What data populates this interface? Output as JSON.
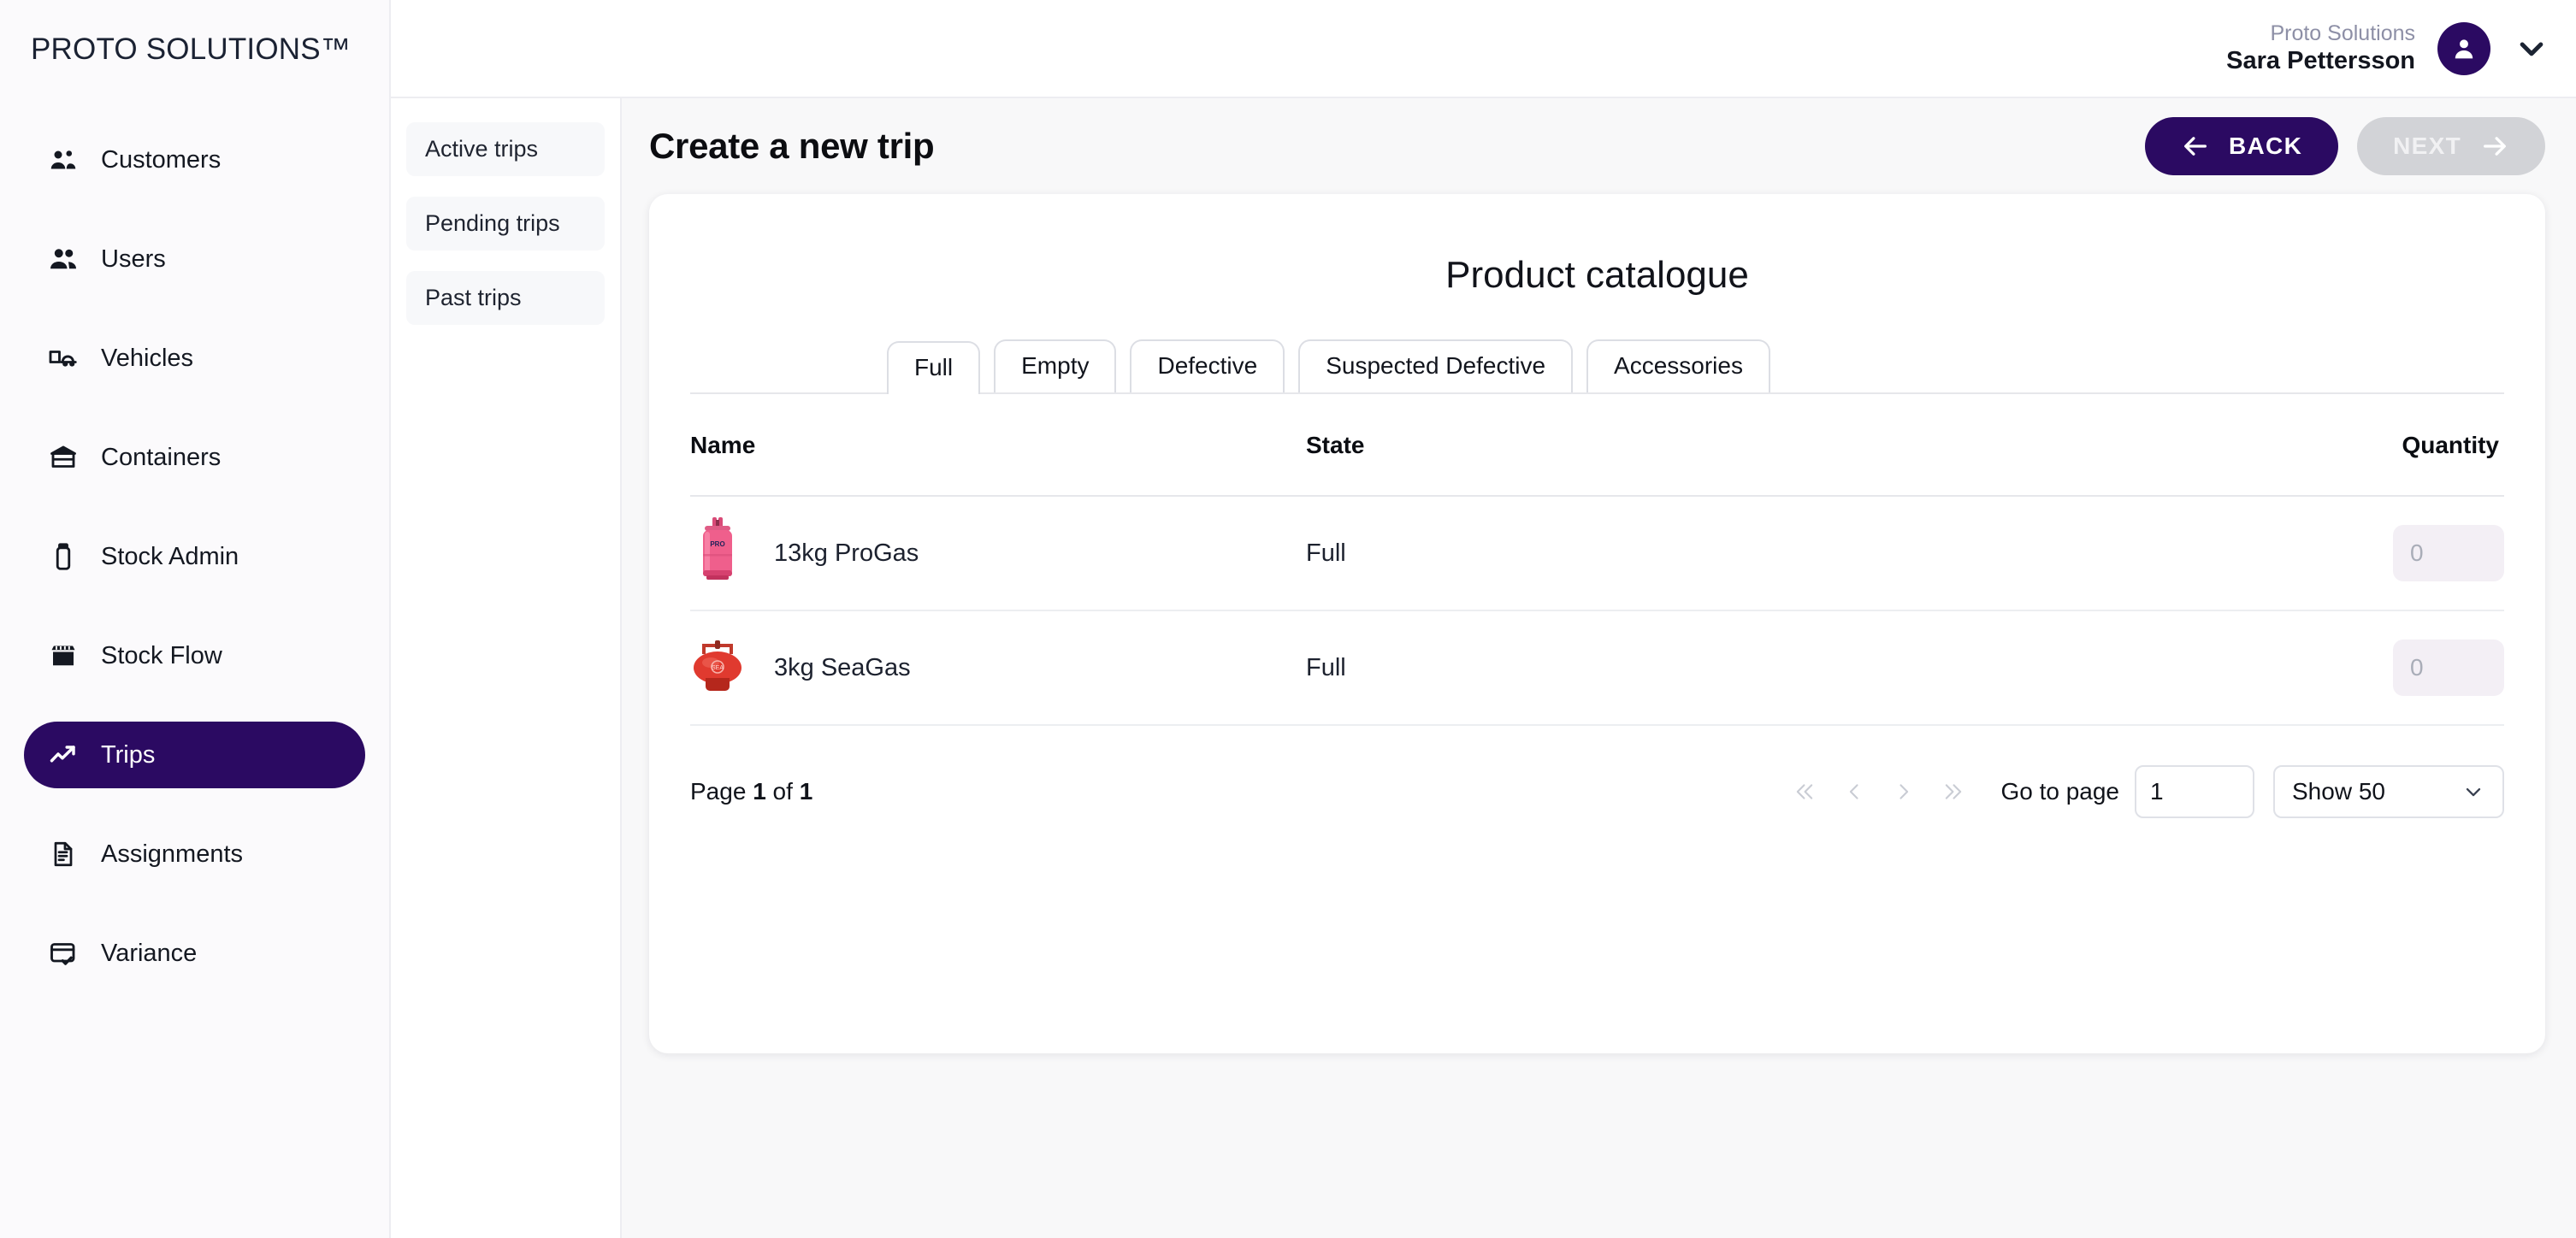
{
  "brand": "PROTO SOLUTIONS™",
  "sidebar": {
    "items": [
      {
        "label": "Customers",
        "icon": "customers-icon",
        "active": false
      },
      {
        "label": "Users",
        "icon": "users-icon",
        "active": false
      },
      {
        "label": "Vehicles",
        "icon": "vehicles-icon",
        "active": false
      },
      {
        "label": "Containers",
        "icon": "containers-icon",
        "active": false
      },
      {
        "label": "Stock Admin",
        "icon": "stock-admin-icon",
        "active": false
      },
      {
        "label": "Stock Flow",
        "icon": "stock-flow-icon",
        "active": false
      },
      {
        "label": "Trips",
        "icon": "trips-icon",
        "active": true
      },
      {
        "label": "Assignments",
        "icon": "assignments-icon",
        "active": false
      },
      {
        "label": "Variance",
        "icon": "variance-icon",
        "active": false
      }
    ],
    "active_color": "#2b0a62"
  },
  "topbar": {
    "org": "Proto Solutions",
    "user_name": "Sara Pettersson",
    "avatar_icon": "user-avatar-icon",
    "caret_icon": "chevron-down-icon"
  },
  "subnav": {
    "items": [
      {
        "label": "Active trips"
      },
      {
        "label": "Pending trips"
      },
      {
        "label": "Past trips"
      }
    ]
  },
  "header": {
    "title": "Create a new trip",
    "back_label": "BACK",
    "next_label": "NEXT",
    "back_icon": "arrow-left-icon",
    "next_icon": "arrow-right-icon",
    "back_color": "#2b0a62",
    "next_color": "#d2d3d7"
  },
  "catalogue": {
    "title": "Product catalogue",
    "tabs": [
      {
        "label": "Full",
        "active": true
      },
      {
        "label": "Empty",
        "active": false
      },
      {
        "label": "Defective",
        "active": false
      },
      {
        "label": "Suspected Defective",
        "active": false
      },
      {
        "label": "Accessories",
        "active": false
      }
    ],
    "columns": {
      "name": "Name",
      "state": "State",
      "quantity": "Quantity"
    },
    "rows": [
      {
        "name": "13kg ProGas",
        "state": "Full",
        "quantity_placeholder": "0",
        "quantity_value": "",
        "image": "pink-gas-cylinder"
      },
      {
        "name": "3kg SeaGas",
        "state": "Full",
        "quantity_placeholder": "0",
        "quantity_value": "",
        "image": "red-gas-cylinder"
      }
    ]
  },
  "pagination": {
    "page_prefix": "Page",
    "page_current": "1",
    "page_middle": "of",
    "page_total": "1",
    "first_icon": "chevron-double-left-icon",
    "prev_icon": "chevron-left-icon",
    "next_icon": "chevron-right-icon",
    "last_icon": "chevron-double-right-icon",
    "goto_label": "Go to page",
    "goto_value": "1",
    "show_label": "Show 50",
    "show_caret_icon": "chevron-down-icon"
  }
}
